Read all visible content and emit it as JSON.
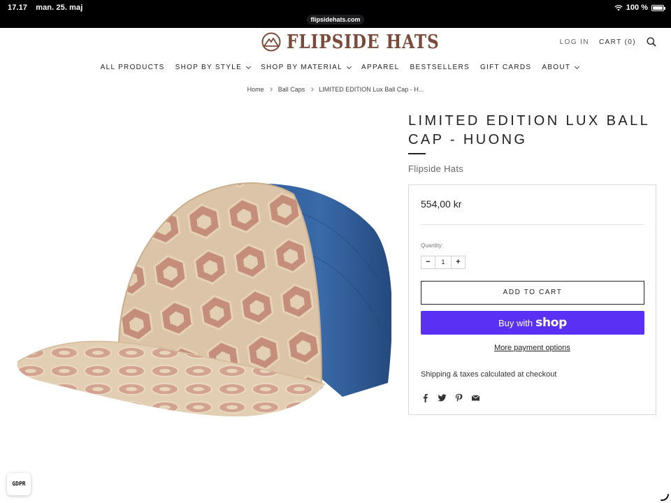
{
  "status_bar": {
    "time": "17.17",
    "date": "man. 25. maj",
    "battery": "100 %",
    "url": "flipsidehats.com"
  },
  "header": {
    "logo_text": "FLIPSIDE HATS",
    "login": "LOG IN",
    "cart": "CART (0)",
    "search_icon": "search-icon"
  },
  "nav": {
    "items": [
      {
        "label": "ALL PRODUCTS",
        "dropdown": false
      },
      {
        "label": "SHOP BY STYLE",
        "dropdown": true
      },
      {
        "label": "SHOP BY MATERIAL",
        "dropdown": true
      },
      {
        "label": "APPAREL",
        "dropdown": false
      },
      {
        "label": "BESTSELLERS",
        "dropdown": false
      },
      {
        "label": "GIFT CARDS",
        "dropdown": false
      },
      {
        "label": "ABOUT",
        "dropdown": true
      }
    ]
  },
  "breadcrumb": {
    "home": "Home",
    "category": "Ball Caps",
    "current": "LIMITED EDITION Lux Ball Cap - H..."
  },
  "product": {
    "title": "LIMITED EDITION LUX BALL CAP - HUONG",
    "vendor": "Flipside Hats",
    "price": "554,00 kr",
    "quantity_label": "Quantity:",
    "quantity": "1",
    "qty_minus": "−",
    "qty_plus": "+",
    "add_to_cart": "ADD TO CART",
    "buy_with": "Buy with",
    "shop_brand": "shop",
    "more_payment": "More payment options",
    "shipping_note": "Shipping & taxes calculated at checkout",
    "share_icons": [
      "facebook-icon",
      "twitter-icon",
      "pinterest-icon",
      "email-icon"
    ]
  },
  "gdpr": "GDPR",
  "colors": {
    "accent_shop": "#5a31f4",
    "logo": "#7a4b3a",
    "border": "#d9d9d9"
  }
}
